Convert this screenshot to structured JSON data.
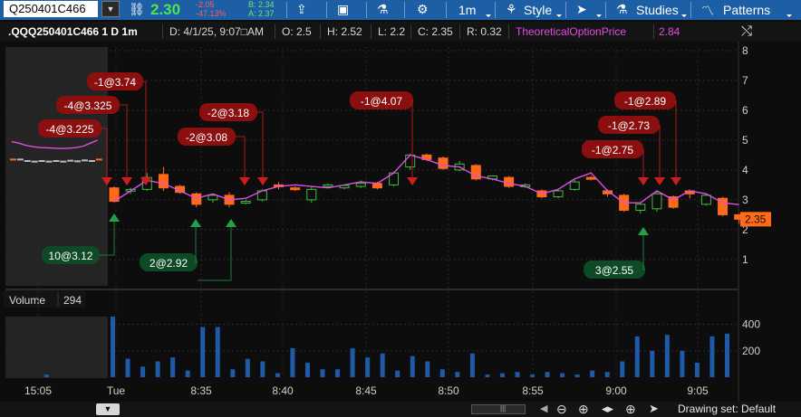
{
  "toolbar": {
    "symbol": "Q250401C466",
    "last_price": "2.30",
    "net_change": "-2.05",
    "percent_change": "-47.13%",
    "bid": "B: 2.34",
    "ask": "A: 2.37",
    "interval_label": "1m",
    "style_label": "Style",
    "studies_label": "Studies",
    "patterns_label": "Patterns",
    "icons": [
      "dropdown-icon",
      "link-icon",
      "share-icon",
      "notebook-icon",
      "flask-icon",
      "gear-icon",
      "cursor-icon"
    ]
  },
  "info_bar": {
    "title": ".QQQ250401C466 1 D 1m",
    "date": "D: 4/1/25, 9:07□AM",
    "open": "O: 2.5",
    "high": "H: 2.52",
    "low": "L: 2.2",
    "close": "C: 2.35",
    "range": "R: 0.32",
    "study_name": "TheoreticalOptionPrice",
    "study_value": "2.84"
  },
  "colors": {
    "toolbar_bg": "#1d5fa5",
    "up": "#3fbf3f",
    "down": "#ff6a1a",
    "study_line": "#e24ce2",
    "sell_marker": "#8b0f0f",
    "buy_marker": "#0e4a26",
    "volume_bar": "#1e5aa8"
  },
  "price_axis": {
    "ticks": [
      "8",
      "7",
      "6",
      "5",
      "4",
      "3",
      "2",
      "1"
    ],
    "last_label": "2.35"
  },
  "volume_panel": {
    "label": "Volume",
    "value": "294",
    "ticks": [
      "400",
      "200"
    ]
  },
  "time_axis": {
    "labels": [
      "15:05",
      "Tue",
      "8:35",
      "8:40",
      "8:45",
      "8:50",
      "8:55",
      "9:00",
      "9:05"
    ]
  },
  "trade_labels": [
    {
      "text": "-4@3.225"
    },
    {
      "text": "-4@3.325"
    },
    {
      "text": "-1@3.74"
    },
    {
      "text": "10@3.12"
    },
    {
      "text": "-2@3.08"
    },
    {
      "text": "-2@3.18"
    },
    {
      "text": "2@2.92"
    },
    {
      "text": "-1@4.07"
    },
    {
      "text": "-1@2.89"
    },
    {
      "text": "-1@2.73"
    },
    {
      "text": "-1@2.75"
    },
    {
      "text": "3@2.55"
    }
  ],
  "status": {
    "drawing_set": "Drawing set: Default",
    "icons": [
      "zoom-out-icon",
      "zoom-in-icon",
      "pan-arrows-icon",
      "crosshair-icon",
      "cursor-icon"
    ]
  },
  "chart_data": {
    "type": "candlestick",
    "time_labels": [
      "15:05",
      "Tue",
      "8:35",
      "8:40",
      "8:45",
      "8:50",
      "8:55",
      "9:00",
      "9:05"
    ],
    "y_ticks": [
      1,
      2,
      3,
      4,
      5,
      6,
      7,
      8
    ],
    "ylim": [
      0.3,
      8.3
    ],
    "volume_ylim": [
      0,
      480
    ],
    "volume_ticks": [
      200,
      400
    ],
    "prior_day": {
      "closes": [
        4.35,
        4.35,
        4.3,
        4.28,
        4.3,
        4.28,
        4.3,
        4.28,
        4.31,
        4.29,
        4.32,
        4.3,
        4.35
      ]
    },
    "candles": [
      {
        "o": 3.4,
        "h": 3.45,
        "c": 2.95,
        "l": 2.9
      },
      {
        "o": 3.3,
        "h": 3.4,
        "c": 3.35,
        "l": 3.2
      },
      {
        "o": 3.35,
        "h": 3.9,
        "c": 3.75,
        "l": 3.3
      },
      {
        "o": 3.85,
        "h": 4.1,
        "c": 3.4,
        "l": 3.3
      },
      {
        "o": 3.45,
        "h": 3.5,
        "c": 3.25,
        "l": 3.2
      },
      {
        "o": 3.2,
        "h": 3.25,
        "c": 2.85,
        "l": 2.75
      },
      {
        "o": 3.0,
        "h": 3.2,
        "c": 3.15,
        "l": 2.9
      },
      {
        "o": 3.15,
        "h": 3.25,
        "c": 2.85,
        "l": 2.75
      },
      {
        "o": 2.9,
        "h": 3.0,
        "c": 2.95,
        "l": 2.85
      },
      {
        "o": 3.0,
        "h": 3.35,
        "c": 3.3,
        "l": 2.95
      },
      {
        "o": 3.5,
        "h": 3.6,
        "c": 3.45,
        "l": 3.35
      },
      {
        "o": 3.4,
        "h": 3.45,
        "c": 3.35,
        "l": 3.3
      },
      {
        "o": 3.0,
        "h": 3.45,
        "c": 3.35,
        "l": 2.9
      },
      {
        "o": 3.5,
        "h": 3.55,
        "c": 3.5,
        "l": 3.4
      },
      {
        "o": 3.4,
        "h": 3.5,
        "c": 3.48,
        "l": 3.35
      },
      {
        "o": 3.45,
        "h": 3.65,
        "c": 3.55,
        "l": 3.4
      },
      {
        "o": 3.55,
        "h": 3.6,
        "c": 3.4,
        "l": 3.35
      },
      {
        "o": 3.5,
        "h": 3.95,
        "c": 3.9,
        "l": 3.45
      },
      {
        "o": 4.1,
        "h": 4.55,
        "c": 4.5,
        "l": 4.0
      },
      {
        "o": 4.5,
        "h": 4.55,
        "c": 4.35,
        "l": 4.3
      },
      {
        "o": 4.4,
        "h": 4.45,
        "c": 4.05,
        "l": 4.0
      },
      {
        "o": 4.0,
        "h": 4.3,
        "c": 4.2,
        "l": 3.95
      },
      {
        "o": 4.15,
        "h": 4.2,
        "c": 3.7,
        "l": 3.65
      },
      {
        "o": 3.7,
        "h": 3.8,
        "c": 3.8,
        "l": 3.65
      },
      {
        "o": 3.75,
        "h": 3.8,
        "c": 3.45,
        "l": 3.4
      },
      {
        "o": 3.5,
        "h": 3.55,
        "c": 3.5,
        "l": 3.4
      },
      {
        "o": 3.3,
        "h": 3.35,
        "c": 3.1,
        "l": 3.05
      },
      {
        "o": 3.1,
        "h": 3.35,
        "c": 3.3,
        "l": 3.05
      },
      {
        "o": 3.35,
        "h": 3.7,
        "c": 3.6,
        "l": 3.3
      },
      {
        "o": 3.75,
        "h": 3.8,
        "c": 3.7,
        "l": 3.65
      },
      {
        "o": 3.3,
        "h": 3.35,
        "c": 3.2,
        "l": 3.1
      },
      {
        "o": 3.15,
        "h": 3.2,
        "c": 2.65,
        "l": 2.6
      },
      {
        "o": 2.65,
        "h": 2.9,
        "c": 2.85,
        "l": 2.55
      },
      {
        "o": 2.7,
        "h": 3.3,
        "c": 3.2,
        "l": 2.6
      },
      {
        "o": 3.1,
        "h": 3.15,
        "c": 2.75,
        "l": 2.7
      },
      {
        "o": 3.3,
        "h": 3.35,
        "c": 3.2,
        "l": 3.05
      },
      {
        "o": 2.85,
        "h": 3.2,
        "c": 3.15,
        "l": 2.8
      },
      {
        "o": 3.05,
        "h": 3.1,
        "c": 2.5,
        "l": 2.45
      },
      {
        "o": 2.5,
        "h": 2.52,
        "c": 2.35,
        "l": 2.2
      }
    ],
    "study_series": {
      "name": "TheoreticalOptionPrice",
      "prior_day": [
        4.95,
        4.9,
        4.82,
        4.78,
        4.75,
        4.74,
        4.73,
        4.72,
        4.73,
        4.75,
        4.8,
        4.9,
        5.0
      ],
      "values": [
        2.95,
        3.3,
        3.65,
        3.55,
        3.3,
        3.05,
        3.2,
        3.0,
        3.05,
        3.3,
        3.45,
        3.5,
        3.45,
        3.4,
        3.5,
        3.6,
        3.55,
        3.9,
        4.5,
        4.35,
        4.15,
        4.1,
        3.8,
        3.7,
        3.55,
        3.45,
        3.2,
        3.35,
        3.7,
        3.9,
        3.3,
        2.9,
        2.9,
        3.3,
        3.0,
        3.3,
        3.2,
        2.9,
        2.84
      ]
    },
    "trade_markers": [
      {
        "side": "sell",
        "qty": -4,
        "price": 3.225,
        "bar": 0
      },
      {
        "side": "sell",
        "qty": -4,
        "price": 3.325,
        "bar": 1
      },
      {
        "side": "sell",
        "qty": -1,
        "price": 3.74,
        "bar": 2
      },
      {
        "side": "buy",
        "qty": 10,
        "price": 3.12,
        "bar": 0
      },
      {
        "side": "sell",
        "qty": -2,
        "price": 3.08,
        "bar": 8
      },
      {
        "side": "sell",
        "qty": -2,
        "price": 3.18,
        "bar": 9
      },
      {
        "side": "buy",
        "qty": 2,
        "price": 2.92,
        "bar": 5
      },
      {
        "side": "buy",
        "qty": 2,
        "price": 2.92,
        "bar": 7
      },
      {
        "side": "sell",
        "qty": -1,
        "price": 4.07,
        "bar": 18
      },
      {
        "side": "sell",
        "qty": -1,
        "price": 2.89,
        "bar": 34
      },
      {
        "side": "sell",
        "qty": -1,
        "price": 2.73,
        "bar": 33
      },
      {
        "side": "sell",
        "qty": -1,
        "price": 2.75,
        "bar": 31
      },
      {
        "side": "buy",
        "qty": 3,
        "price": 2.55,
        "bar": 32
      }
    ],
    "volume": {
      "prior_day": [
        0,
        0,
        20,
        0,
        0,
        0,
        0,
        0,
        0,
        0,
        0,
        0,
        0
      ],
      "values": [
        460,
        140,
        80,
        120,
        150,
        50,
        380,
        380,
        60,
        140,
        120,
        30,
        220,
        110,
        60,
        60,
        220,
        150,
        180,
        50,
        160,
        120,
        60,
        40,
        180,
        20,
        30,
        40,
        20,
        40,
        30,
        20,
        50,
        40,
        120,
        310,
        200,
        320,
        200,
        110,
        310,
        330
      ]
    }
  }
}
